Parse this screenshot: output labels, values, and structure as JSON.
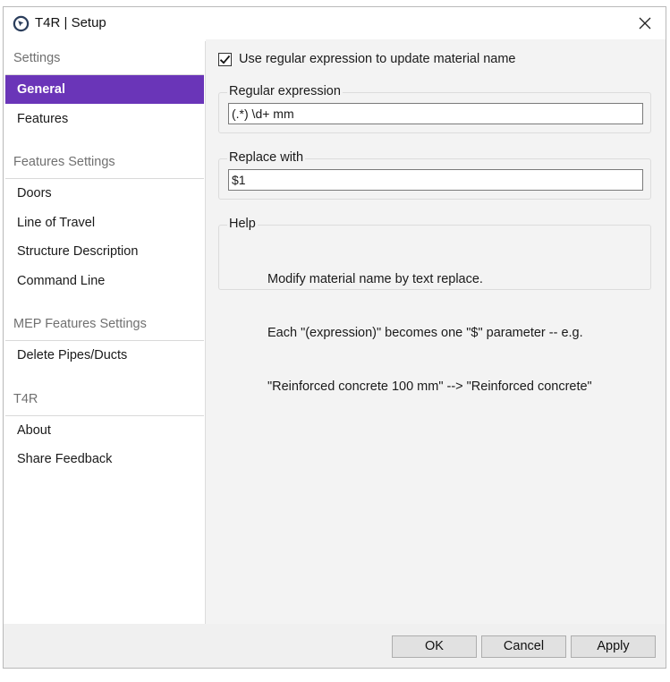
{
  "window": {
    "title": "T4R | Setup"
  },
  "sidebar": {
    "sections": [
      {
        "header": "Settings",
        "items": [
          "General",
          "Features"
        ]
      },
      {
        "header": "Features Settings",
        "items": [
          "Doors",
          "Line of Travel",
          "Structure Description",
          "Command Line"
        ]
      },
      {
        "header": "MEP Features Settings",
        "items": [
          "Delete Pipes/Ducts"
        ]
      },
      {
        "header": "T4R",
        "items": [
          "About",
          "Share Feedback"
        ]
      }
    ],
    "active_item": "General"
  },
  "main": {
    "checkbox": {
      "label": "Use regular expression to update material name",
      "checked": true
    },
    "regex_group": {
      "title": "Regular expression",
      "value": "(.*) \\d+ mm"
    },
    "replace_group": {
      "title": "Replace with",
      "value": "$1"
    },
    "help_group": {
      "title": "Help",
      "lines": [
        "Modify material name by text replace.",
        "Each \"(expression)\" becomes one \"$\" parameter -- e.g.",
        "\"Reinforced concrete 100 mm\" --> \"Reinforced concrete\""
      ]
    }
  },
  "footer": {
    "ok": "OK",
    "cancel": "Cancel",
    "apply": "Apply"
  },
  "colors": {
    "accent": "#6a35b8",
    "app_icon": "#2b3e5c"
  },
  "icons": {
    "app": "t4r-logo-icon",
    "close": "close-icon",
    "check": "checkmark-icon"
  }
}
